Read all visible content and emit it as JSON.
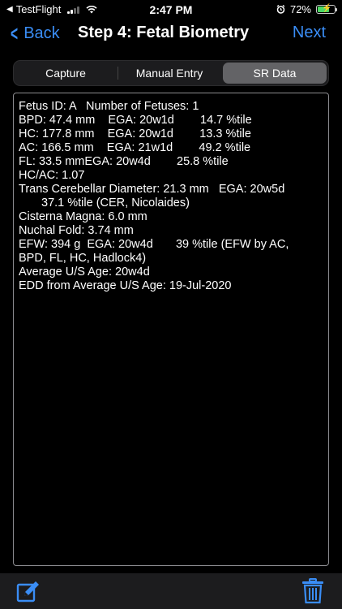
{
  "status_bar": {
    "back_app": "TestFlight",
    "time": "2:47 PM",
    "battery_percent": "72%",
    "battery_level": 0.72,
    "icons": [
      "back-arrow-icon",
      "signal-icon",
      "wifi-icon",
      "alarm-icon",
      "battery-charging-icon"
    ]
  },
  "nav": {
    "back_label": "Back",
    "title": "Step 4: Fetal Biometry",
    "next_label": "Next"
  },
  "tabs": [
    {
      "label": "Capture",
      "selected": false
    },
    {
      "label": "Manual Entry",
      "selected": false
    },
    {
      "label": "SR Data",
      "selected": true
    }
  ],
  "report": {
    "lines": [
      "Fetus ID: A   Number of Fetuses: 1",
      "BPD: 47.4 mm    EGA: 20w1d        14.7 %tile",
      "HC: 177.8 mm    EGA: 20w1d        13.3 %tile",
      "AC: 166.5 mm    EGA: 21w1d        49.2 %tile",
      "FL: 33.5 mmEGA: 20w4d        25.8 %tile",
      "HC/AC: 1.07",
      "Trans Cerebellar Diameter: 21.3 mm   EGA: 20w5d",
      "37.1 %tile (CER, Nicolaides)",
      "Cisterna Magna: 6.0 mm",
      "Nuchal Fold: 3.74 mm",
      "EFW: 394 g  EGA: 20w4d       39 %tile (EFW by AC,",
      "BPD, FL, HC, Hadlock4)",
      "Average U/S Age: 20w4d",
      "EDD from Average U/S Age: 19-Jul-2020"
    ]
  },
  "toolbar": {
    "edit_icon": "compose-icon",
    "trash_icon": "trash-icon"
  },
  "colors": {
    "accent": "#3A8DF5",
    "background": "#000000",
    "toolbar": "#1C1C1E",
    "segment_selected": "#636366",
    "battery": "#4CD964"
  }
}
